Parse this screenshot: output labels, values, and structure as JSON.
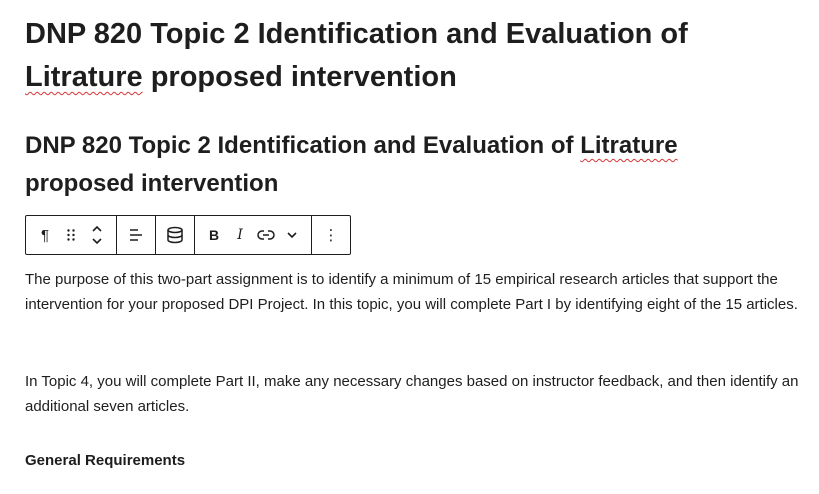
{
  "post_title": {
    "part1": "DNP 820 Topic 2 Identification and Evaluation of ",
    "misspelled": "Litrature",
    "part2": " proposed intervention"
  },
  "heading": {
    "part1": "DNP 820 Topic 2 Identification and Evaluation of ",
    "misspelled": "Litrature",
    "part2": " proposed intervention"
  },
  "toolbar": {
    "icons": [
      "paragraph-icon",
      "drag-handle-icon",
      "move-up-down-icon",
      "align-icon",
      "database-icon",
      "bold-icon",
      "italic-icon",
      "link-icon",
      "chevron-down-icon",
      "more-options-icon"
    ],
    "paragraph_glyph": "¶",
    "bold_glyph": "B",
    "italic_glyph": "I",
    "more_glyph": "⋮"
  },
  "content": {
    "paragraph1": "The purpose of this two-part assignment is to identify a minimum of 15 empirical research articles that support the intervention for your proposed DPI Project. In this topic, you will complete Part I by identifying eight of the 15 articles.",
    "paragraph2": "In Topic 4, you will complete Part II, make any necessary changes based on instructor feedback, and then identify an additional seven articles.",
    "subheading": "General Requirements"
  }
}
